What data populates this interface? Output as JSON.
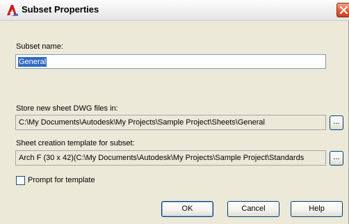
{
  "window": {
    "title": "Subset Properties",
    "icons": {
      "app": "autocad-icon",
      "close": "close-icon"
    },
    "colors": {
      "dialog_bg": "#ece9d8",
      "selection": "#316ac5",
      "close_button": "#e05a3a"
    }
  },
  "subset_name": {
    "label": "Subset name:",
    "value": "General"
  },
  "store_location": {
    "label": "Store new sheet DWG files in:",
    "value": "C:\\My Documents\\Autodesk\\My Projects\\Sample Project\\Sheets\\General",
    "browse_label": "..."
  },
  "template": {
    "label": "Sheet creation template for subset:",
    "value": "Arch F (30 x 42)(C:\\My Documents\\Autodesk\\My Projects\\Sample Project\\Standards",
    "browse_label": "..."
  },
  "prompt_for_template": {
    "label": "Prompt for template",
    "checked": false
  },
  "buttons": {
    "ok": "OK",
    "cancel": "Cancel",
    "help": "Help"
  }
}
